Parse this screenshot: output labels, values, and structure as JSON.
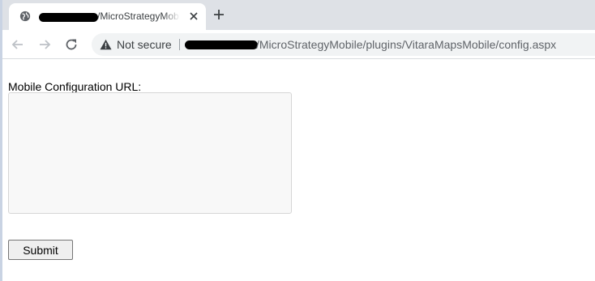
{
  "browser": {
    "tab": {
      "title": "/MicroStrategyMobi",
      "favicon": "globe-icon",
      "close_icon": "close-icon"
    },
    "new_tab_icon": "plus-icon",
    "toolbar": {
      "back_icon": "arrow-left-icon",
      "forward_icon": "arrow-right-icon",
      "reload_icon": "reload-icon"
    },
    "omnibox": {
      "security_icon": "warning-icon",
      "security_text": "Not secure",
      "url_path": "/MicroStrategyMobile/plugins/VitaraMapsMobile/config.aspx"
    }
  },
  "form": {
    "label": "Mobile Configuration URL:",
    "textarea_value": "",
    "submit_label": "Submit"
  },
  "colors": {
    "tabstrip": "#dee1e6",
    "omnibox": "#f1f3f4",
    "button": "#efefef"
  }
}
